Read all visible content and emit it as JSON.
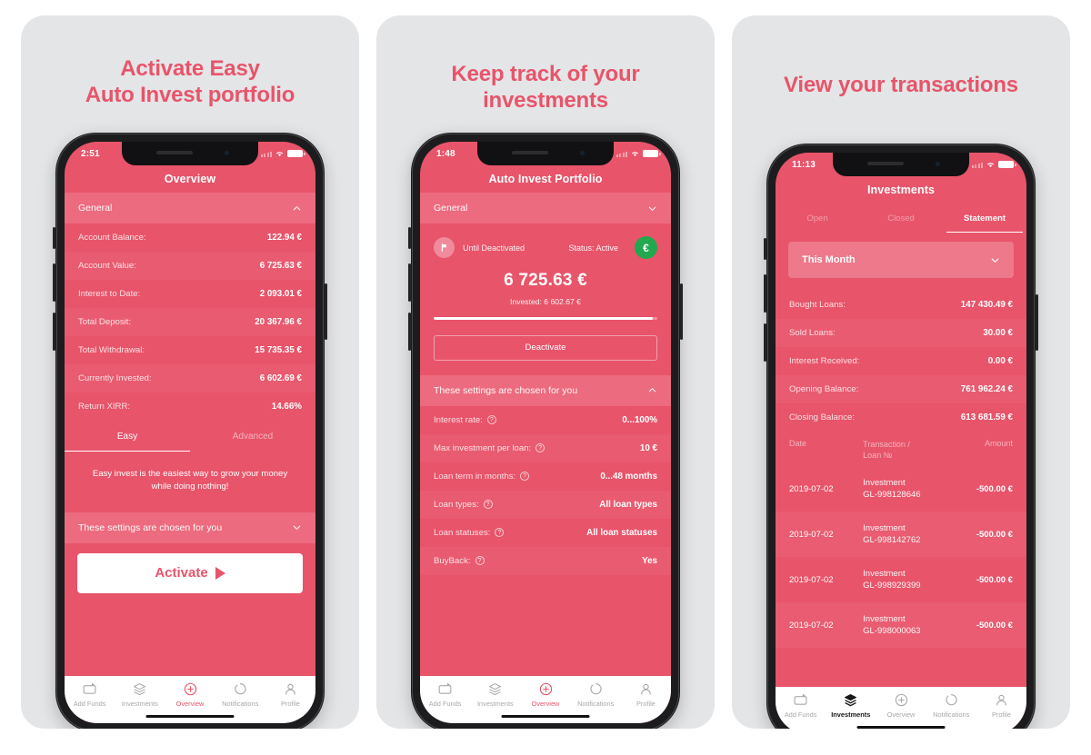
{
  "panels": [
    {
      "headline": "Activate Easy\nAuto Invest portfolio",
      "status": {
        "time": "2:51"
      },
      "nav_title": "Overview",
      "general_band": "General",
      "rows": [
        {
          "label": "Account Balance:",
          "value": "122.94 €"
        },
        {
          "label": "Account Value:",
          "value": "6 725.63 €"
        },
        {
          "label": "Interest to Date:",
          "value": "2 093.01 €"
        },
        {
          "label": "Total Deposit:",
          "value": "20 367.96 €"
        },
        {
          "label": "Total Withdrawal:",
          "value": "15 735.35 €"
        },
        {
          "label": "Currently Invested:",
          "value": "6 602.69 €"
        },
        {
          "label": "Return XIRR:",
          "value": "14.66%"
        }
      ],
      "tabs": [
        {
          "label": "Easy",
          "active": true
        },
        {
          "label": "Advanced",
          "active": false
        }
      ],
      "blurb": "Easy invest is the easiest way to grow your money while doing nothing!",
      "settings_band": "These settings are chosen for you",
      "cta_label": "Activate",
      "tabbar": [
        {
          "label": "Add Funds",
          "icon": "add-funds-icon",
          "state": "idle"
        },
        {
          "label": "Investments",
          "icon": "investments-icon",
          "state": "idle"
        },
        {
          "label": "Overview",
          "icon": "overview-icon",
          "state": "accent"
        },
        {
          "label": "Notifications",
          "icon": "notifications-icon",
          "state": "idle"
        },
        {
          "label": "Profile",
          "icon": "profile-icon",
          "state": "idle"
        }
      ]
    },
    {
      "headline": "Keep track of your\ninvestments",
      "status": {
        "time": "1:48"
      },
      "nav_title": "Auto Invest Portfolio",
      "general_band": "General",
      "card": {
        "until": "Until Deactivated",
        "status": "Status: Active",
        "currency": "€",
        "amount": "6 725.63 €",
        "invested": "Invested: 6 602.67 €",
        "deactivate_label": "Deactivate"
      },
      "settings_band": "These settings are chosen for you",
      "settings": [
        {
          "label": "Interest rate:",
          "help": "?",
          "value": "0...100%"
        },
        {
          "label": "Max investment per loan:",
          "help": "?",
          "value": "10 €"
        },
        {
          "label": "Loan term in months:",
          "help": "?",
          "value": "0...48 months"
        },
        {
          "label": "Loan types:",
          "help": "?",
          "value": "All loan types"
        },
        {
          "label": "Loan statuses:",
          "help": "?",
          "value": "All loan statuses"
        },
        {
          "label": "BuyBack:",
          "help": "?",
          "value": "Yes"
        }
      ],
      "tabbar": [
        {
          "label": "Add Funds",
          "icon": "add-funds-icon",
          "state": "idle"
        },
        {
          "label": "Investments",
          "icon": "investments-icon",
          "state": "idle"
        },
        {
          "label": "Overview",
          "icon": "overview-icon",
          "state": "accent"
        },
        {
          "label": "Notifications",
          "icon": "notifications-icon",
          "state": "idle"
        },
        {
          "label": "Profile",
          "icon": "profile-icon",
          "state": "idle"
        }
      ]
    },
    {
      "headline": "View your transactions",
      "status": {
        "time": "11:13"
      },
      "nav_title": "Investments",
      "segments": [
        {
          "label": "Open",
          "active": false
        },
        {
          "label": "Closed",
          "active": false
        },
        {
          "label": "Statement",
          "active": true
        }
      ],
      "period_filter": "This Month",
      "summary": [
        {
          "label": "Bought Loans:",
          "value": "147 430.49 €"
        },
        {
          "label": "Sold Loans:",
          "value": "30.00 €"
        },
        {
          "label": "Interest Received:",
          "value": "0.00 €"
        },
        {
          "label": "Opening Balance:",
          "value": "761 962.24 €"
        },
        {
          "label": "Closing Balance:",
          "value": "613 681.59 €"
        }
      ],
      "table": {
        "headers": {
          "date": "Date",
          "transaction": "Transaction /\nLoan №",
          "amount": "Amount"
        },
        "rows": [
          {
            "date": "2019-07-02",
            "type": "Investment",
            "loan": "GL-998128646",
            "amount": "-500.00 €"
          },
          {
            "date": "2019-07-02",
            "type": "Investment",
            "loan": "GL-998142762",
            "amount": "-500.00 €"
          },
          {
            "date": "2019-07-02",
            "type": "Investment",
            "loan": "GL-998929399",
            "amount": "-500.00 €"
          },
          {
            "date": "2019-07-02",
            "type": "Investment",
            "loan": "GL-998000063",
            "amount": "-500.00 €"
          }
        ]
      },
      "tabbar": [
        {
          "label": "Add Funds",
          "icon": "add-funds-icon",
          "state": "idle"
        },
        {
          "label": "Investments",
          "icon": "investments-icon",
          "state": "dark"
        },
        {
          "label": "Overview",
          "icon": "overview-icon",
          "state": "idle"
        },
        {
          "label": "Notifications",
          "icon": "notifications-icon",
          "state": "idle"
        },
        {
          "label": "Profile",
          "icon": "profile-icon",
          "state": "idle"
        }
      ]
    }
  ],
  "theme": {
    "accent": "#e8546a",
    "accent_light": "#ed6b7e",
    "panel_bg": "#e4e5e7",
    "green": "#22a84f",
    "page_bg": "#ffffff"
  }
}
